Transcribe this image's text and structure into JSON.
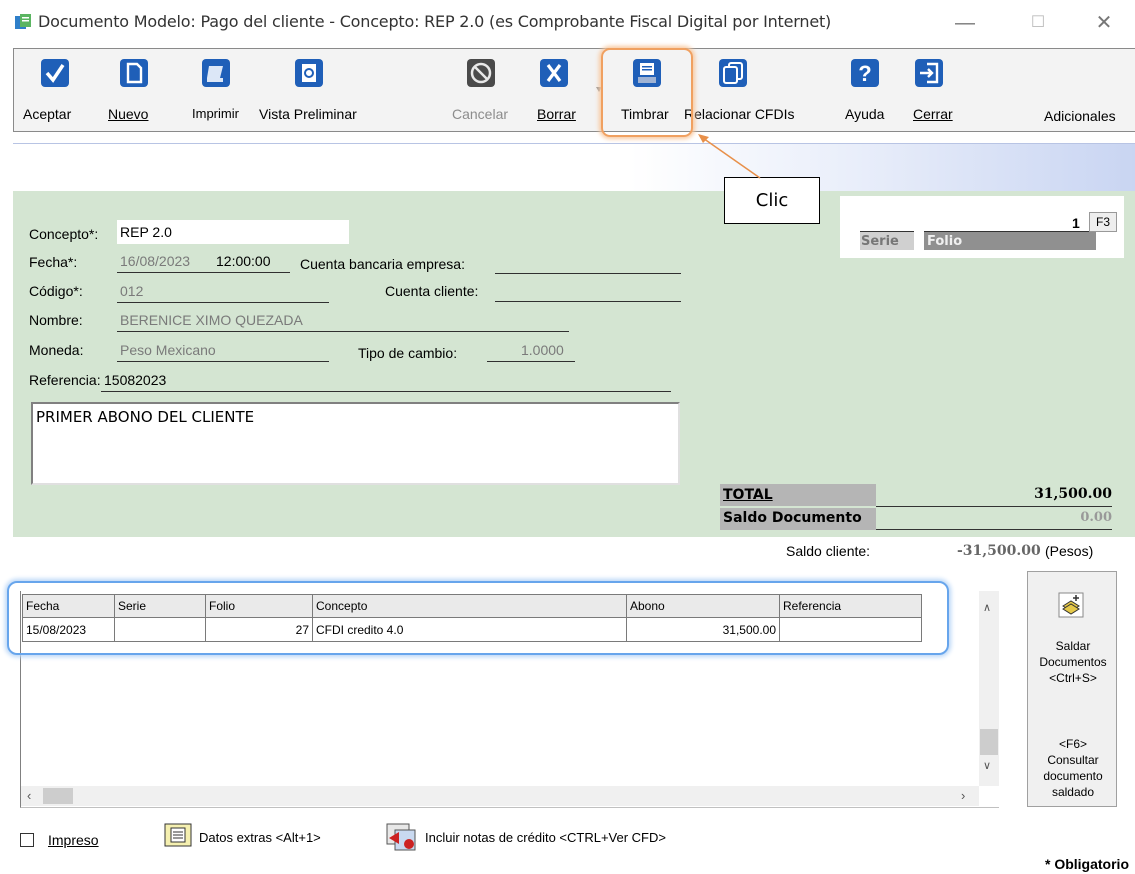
{
  "window": {
    "title": "Documento Modelo: Pago del cliente - Concepto: REP 2.0 (es Comprobante Fiscal Digital por Internet)",
    "minimize": "—",
    "maximize": "☐",
    "close": "✕"
  },
  "toolbar": {
    "aceptar": "Aceptar",
    "nuevo": "Nuevo",
    "imprimir": "Imprimir",
    "vista_preliminar": "Vista Preliminar",
    "cancelar": "Cancelar",
    "borrar": "Borrar",
    "timbrar": "Timbrar",
    "relacionar": "Relacionar CFDIs",
    "ayuda": "Ayuda",
    "cerrar": "Cerrar",
    "adicionales": "Adicionales"
  },
  "callout": {
    "text": "Clic"
  },
  "form": {
    "concepto_label": "Concepto*:",
    "concepto_value": "REP 2.0",
    "fecha_label": "Fecha*:",
    "fecha_value": "16/08/2023",
    "hora_value": "12:00:00",
    "cuenta_empresa_label": "Cuenta bancaria empresa:",
    "codigo_label": "Código*:",
    "codigo_value": "012",
    "cuenta_cliente_label": "Cuenta cliente:",
    "nombre_label": "Nombre:",
    "nombre_value": "BERENICE XIMO QUEZADA",
    "moneda_label": "Moneda:",
    "moneda_value": "Peso Mexicano",
    "tipo_cambio_label": "Tipo de cambio:",
    "tipo_cambio_value": "1.0000",
    "referencia_label": "Referencia:",
    "referencia_value": "15082023",
    "memo": "PRIMER ABONO DEL CLIENTE"
  },
  "folio": {
    "value": "1",
    "f3": "F3",
    "serie_label": "Serie",
    "folio_label": "Folio"
  },
  "totals": {
    "total_label": "TOTAL",
    "total_value": "31,500.00",
    "saldo_doc_label": "Saldo Documento",
    "saldo_doc_value": "0.00",
    "saldo_cliente_label": "Saldo cliente:",
    "saldo_cliente_value": "-31,500.00",
    "saldo_cliente_currency": "(Pesos)"
  },
  "grid": {
    "headers": [
      "Fecha",
      "Serie",
      "Folio",
      "Concepto",
      "Abono",
      "Referencia"
    ],
    "rows": [
      [
        "15/08/2023",
        "",
        "27",
        "CFDI credito 4.0",
        "31,500.00",
        ""
      ]
    ]
  },
  "side": {
    "saldar": "Saldar",
    "documentos": "Documentos",
    "saldar_shortcut": "<Ctrl+S>",
    "f6": "<F6>",
    "consultar": "Consultar",
    "documento": "documento",
    "saldado": "saldado"
  },
  "bottom": {
    "impreso": "Impreso",
    "datos_extras": "Datos extras  <Alt+1>",
    "incluir_notas": "Incluir notas de crédito <CTRL+Ver CFD>",
    "obligatorio": "* Obligatorio"
  },
  "colors": {
    "form_bg": "#d4e5d2",
    "icon_blue": "#1f5fb8",
    "highlight_orange": "#f0a060",
    "highlight_blue": "#67a5ec"
  }
}
